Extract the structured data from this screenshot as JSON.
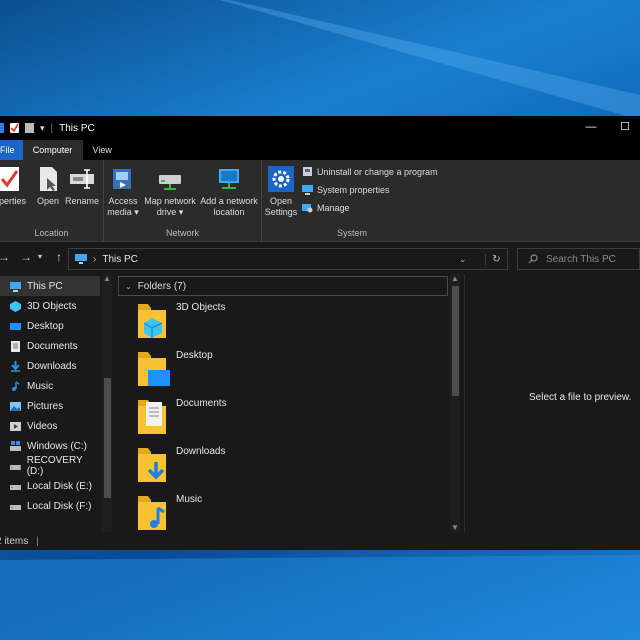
{
  "window": {
    "title": "This PC"
  },
  "tabs": {
    "file": "File",
    "computer": "Computer",
    "view": "View"
  },
  "ribbon": {
    "location": {
      "label": "Location",
      "properties": "operties",
      "open": "Open",
      "rename": "Rename"
    },
    "network": {
      "label": "Network",
      "access_media_1": "Access",
      "access_media_2": "media ▾",
      "map_drive_1": "Map network",
      "map_drive_2": "drive ▾",
      "add_location_1": "Add a network",
      "add_location_2": "location"
    },
    "system": {
      "label": "System",
      "open_settings_1": "Open",
      "open_settings_2": "Settings",
      "uninstall": "Uninstall or change a program",
      "system_properties": "System properties",
      "manage": "Manage"
    }
  },
  "address": {
    "path": "This PC",
    "search_placeholder": "Search This PC"
  },
  "nav_items": [
    {
      "label": "This PC",
      "icon": "pc-icon",
      "selected": true
    },
    {
      "label": "3D Objects",
      "icon": "3d-objects-icon"
    },
    {
      "label": "Desktop",
      "icon": "desktop-icon"
    },
    {
      "label": "Documents",
      "icon": "documents-icon"
    },
    {
      "label": "Downloads",
      "icon": "downloads-icon"
    },
    {
      "label": "Music",
      "icon": "music-icon"
    },
    {
      "label": "Pictures",
      "icon": "pictures-icon"
    },
    {
      "label": "Videos",
      "icon": "videos-icon"
    },
    {
      "label": "Windows (C:)",
      "icon": "windows-drive-icon"
    },
    {
      "label": "RECOVERY (D:)",
      "icon": "drive-icon"
    },
    {
      "label": "Local Disk (E:)",
      "icon": "drive-icon"
    },
    {
      "label": "Local Disk (F:)",
      "icon": "drive-icon"
    }
  ],
  "content": {
    "group_header": "Folders (7)",
    "folders": [
      {
        "name": "3D Objects",
        "icon": "3d-objects-folder-icon"
      },
      {
        "name": "Desktop",
        "icon": "desktop-folder-icon"
      },
      {
        "name": "Documents",
        "icon": "documents-folder-icon"
      },
      {
        "name": "Downloads",
        "icon": "downloads-folder-icon"
      },
      {
        "name": "Music",
        "icon": "music-folder-icon"
      }
    ]
  },
  "preview": {
    "text": "Select a file to preview."
  },
  "status": {
    "items": "2 items"
  },
  "colors": {
    "accent": "#1a66c7",
    "background": "#191919",
    "ribbon": "#2b2b2b",
    "folder": "#f6c433"
  }
}
